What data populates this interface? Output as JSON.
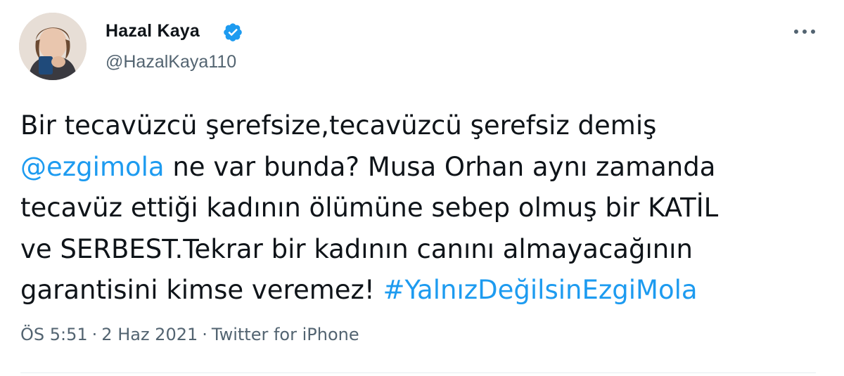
{
  "author": {
    "name": "Hazal Kaya",
    "handle": "@HazalKaya110",
    "verified_icon": "verified-badge-icon",
    "avatar": "profile-photo"
  },
  "menu": {
    "icon": "more-options-icon"
  },
  "tweet": {
    "lines": [
      "Bir tecavüzcü şerefsize,tecavüzcü şerefsiz demiş",
      " ne var bunda? Musa Orhan aynı zamanda",
      "tecavüz ettiği kadının ölümüne sebep olmuş bir KATİL",
      "ve SERBEST.Tekrar bir kadının canını almayacağının",
      "garantisini kimse veremez! "
    ],
    "mention": "@ezgimola",
    "hashtag": "#YalnızDeğilsinEzgiMola"
  },
  "meta": {
    "time": "ÖS 5:51",
    "separator": "·",
    "date": "2 Haz 2021",
    "source": "Twitter for iPhone"
  },
  "colors": {
    "link": "#1d9bf0",
    "secondary_text": "#536471",
    "text": "#0f1419"
  }
}
